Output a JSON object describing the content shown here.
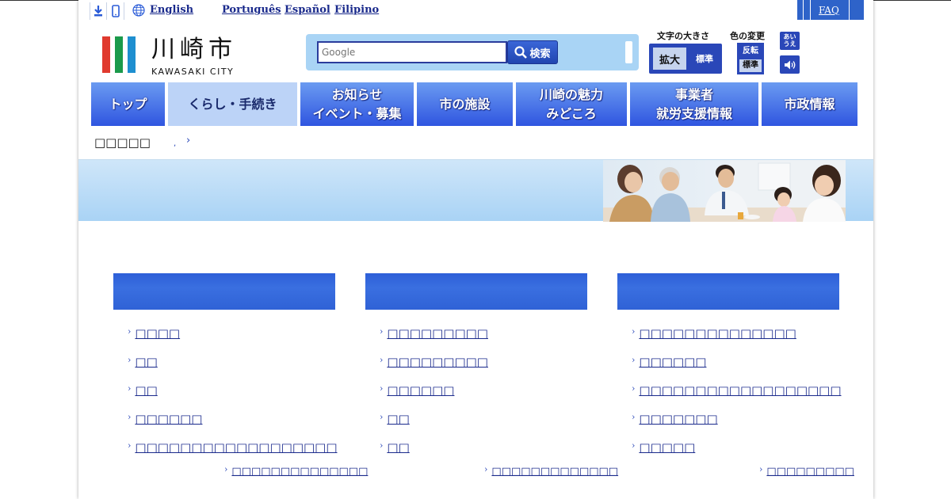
{
  "languages": {
    "english": "English",
    "portuguese": "Português",
    "spanish": "Español",
    "filipino": "Filipino"
  },
  "faq": "FAQ",
  "logo": {
    "kanji": "川崎市",
    "roman": "KAWASAKI CITY",
    "stripe_colors": [
      "#e03a2f",
      "#1b9a4b",
      "#1e8fd0"
    ]
  },
  "search": {
    "placeholder": "Google",
    "button_label": "検索"
  },
  "text_size": {
    "label": "文字の大きさ",
    "enlarge": "拡大",
    "standard": "標準"
  },
  "color_change": {
    "label": "色の変更",
    "invert": "反転",
    "standard": "標準"
  },
  "ruby": "あい\nうえ",
  "nav": {
    "items": [
      {
        "label": "トップ"
      },
      {
        "label": "くらし・手続き"
      },
      {
        "label1": "お知らせ",
        "label2": "イベント・募集"
      },
      {
        "label": "市の施設"
      },
      {
        "label1": "川崎の魅力",
        "label2": "みどころ"
      },
      {
        "label1": "事業者",
        "label2": "就労支援情報"
      },
      {
        "label": "市政情報"
      }
    ]
  },
  "breadcrumb": {
    "current": "□□□□□",
    "dot": ",",
    "chevron": "›"
  },
  "columns": [
    {
      "items": [
        "□□□□",
        "□□",
        "□□",
        "□□□□□□",
        "□□□□□□□□□□□□□□□□□□"
      ],
      "more": "□□□□□□□□□□□□□□"
    },
    {
      "items": [
        "□□□□□□□□□",
        "□□□□□□□□□",
        "□□□□□□",
        "□□",
        "□□"
      ],
      "more": "□□□□□□□□□□□□□"
    },
    {
      "items": [
        "□□□□□□□□□□□□□□",
        "□□□□□□",
        "□□□□□□□□□□□□□□□□□□",
        "□□□□□□□",
        "□□□□□"
      ],
      "more": "□□□□□□□□□"
    }
  ],
  "chevron": "›",
  "colors": {
    "accent": "#2a47b8",
    "nav_gradient_top": "#6b9bf1",
    "nav_gradient_bottom": "#2f55e0",
    "column_header": "#3468d9",
    "banner": "#b9dcf7",
    "link": "#1a2a8c"
  }
}
